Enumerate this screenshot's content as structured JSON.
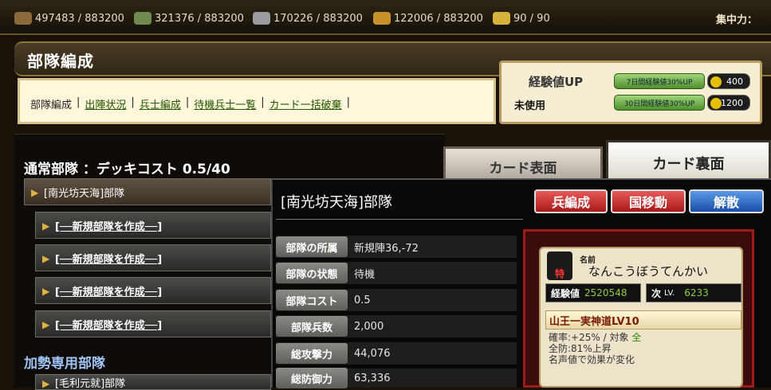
{
  "resources": [
    {
      "name": "wood",
      "value": "497483 / 883200",
      "color": "#8a6a3a"
    },
    {
      "name": "cotton",
      "value": "321376 / 883200",
      "color": "#6e8a50"
    },
    {
      "name": "iron",
      "value": "170226 / 883200",
      "color": "#9a9aa0"
    },
    {
      "name": "food",
      "value": "122006 / 883200",
      "color": "#c8922a"
    },
    {
      "name": "troops",
      "value": "90 / 90",
      "color": "#d7b23a"
    }
  ],
  "concentration_label": "集中力：",
  "header": {
    "title": "部隊編成"
  },
  "nav": {
    "current": "部隊編成",
    "links": [
      "出陣状況",
      "兵士編成",
      "待機兵士一覧",
      "カード一括破棄"
    ],
    "sep": "|"
  },
  "exp": {
    "title": "経験値UP",
    "status": "未使用",
    "items": [
      {
        "label": "7日間経験値30%UP",
        "cost": "400"
      },
      {
        "label": "30日間経験値30%UP",
        "cost": "1200"
      }
    ]
  },
  "normal": {
    "title": "通常部隊 ：デッキコスト",
    "cost": "0.5/40"
  },
  "decks": [
    "[南光坊天海]部隊",
    "[──新規部隊を作成──]",
    "[──新規部隊を作成──]",
    "[──新規部隊を作成──]",
    "[──新規部隊を作成──]"
  ],
  "support": {
    "title": "加勢専用部隊",
    "first": "[毛利元就]部隊"
  },
  "tabs": {
    "front": "カード表面",
    "back": "カード裏面"
  },
  "detail": {
    "title": "[南光坊天海]部隊",
    "buttons": [
      "兵編成",
      "国移動",
      "解散"
    ],
    "props": [
      {
        "label": "部隊の所属",
        "value": "新規陣36,-72"
      },
      {
        "label": "部隊の状態",
        "value": "待機"
      },
      {
        "label": "部隊コスト",
        "value": "0.5"
      },
      {
        "label": "部隊兵数",
        "value": "2,000"
      },
      {
        "label": "総攻撃力",
        "value": "44,076"
      },
      {
        "label": "総防御力",
        "value": "63,336"
      }
    ]
  },
  "card": {
    "name_label": "名前",
    "name": "なんこうぼうてんかい",
    "rarity_icon": "特",
    "exp_label": "経験値",
    "exp": "2520548",
    "next_label": "次",
    "next_lv": "LV.",
    "next": "6233",
    "skill": "山王一実神道LV10",
    "skill_rate": "確率:+25% / 対象",
    "skill_target": "全",
    "skill_effect": "全防:81%上昇",
    "skill_note": "名声値で効果が変化"
  }
}
